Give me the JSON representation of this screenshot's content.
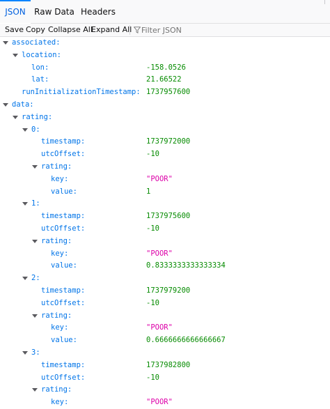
{
  "tabs": [
    {
      "label": "JSON",
      "active": true
    },
    {
      "label": "Raw Data",
      "active": false
    },
    {
      "label": "Headers",
      "active": false
    }
  ],
  "toolbar": {
    "save": "Save",
    "copy": "Copy",
    "collapse_all": "Collapse All",
    "expand_all": "Expand All",
    "filter_placeholder": "Filter JSON"
  },
  "colors": {
    "accent": "#0a84ff",
    "key": "#0074e8",
    "number": "#058b00",
    "string": "#dd00a9"
  },
  "tree": [
    {
      "key": "associated:",
      "level": 0,
      "expandable": true
    },
    {
      "key": "location:",
      "level": 1,
      "expandable": true
    },
    {
      "key": "lon:",
      "level": 2,
      "value": "-158.0526",
      "type": "number"
    },
    {
      "key": "lat:",
      "level": 2,
      "value": "21.66522",
      "type": "number"
    },
    {
      "key": "runInitializationTimestamp:",
      "level": 1,
      "value": "1737957600",
      "type": "number"
    },
    {
      "key": "data:",
      "level": 0,
      "expandable": true
    },
    {
      "key": "rating:",
      "level": 1,
      "expandable": true
    },
    {
      "key": "0:",
      "level": 2,
      "expandable": true
    },
    {
      "key": "timestamp:",
      "level": 3,
      "value": "1737972000",
      "type": "number"
    },
    {
      "key": "utcOffset:",
      "level": 3,
      "value": "-10",
      "type": "number"
    },
    {
      "key": "rating:",
      "level": 3,
      "expandable": true
    },
    {
      "key": "key:",
      "level": 4,
      "value": "\"POOR\"",
      "type": "string"
    },
    {
      "key": "value:",
      "level": 4,
      "value": "1",
      "type": "number"
    },
    {
      "key": "1:",
      "level": 2,
      "expandable": true
    },
    {
      "key": "timestamp:",
      "level": 3,
      "value": "1737975600",
      "type": "number"
    },
    {
      "key": "utcOffset:",
      "level": 3,
      "value": "-10",
      "type": "number"
    },
    {
      "key": "rating:",
      "level": 3,
      "expandable": true
    },
    {
      "key": "key:",
      "level": 4,
      "value": "\"POOR\"",
      "type": "string"
    },
    {
      "key": "value:",
      "level": 4,
      "value": "0.8333333333333334",
      "type": "number"
    },
    {
      "key": "2:",
      "level": 2,
      "expandable": true
    },
    {
      "key": "timestamp:",
      "level": 3,
      "value": "1737979200",
      "type": "number"
    },
    {
      "key": "utcOffset:",
      "level": 3,
      "value": "-10",
      "type": "number"
    },
    {
      "key": "rating:",
      "level": 3,
      "expandable": true
    },
    {
      "key": "key:",
      "level": 4,
      "value": "\"POOR\"",
      "type": "string"
    },
    {
      "key": "value:",
      "level": 4,
      "value": "0.6666666666666667",
      "type": "number"
    },
    {
      "key": "3:",
      "level": 2,
      "expandable": true
    },
    {
      "key": "timestamp:",
      "level": 3,
      "value": "1737982800",
      "type": "number"
    },
    {
      "key": "utcOffset:",
      "level": 3,
      "value": "-10",
      "type": "number"
    },
    {
      "key": "rating:",
      "level": 3,
      "expandable": true
    },
    {
      "key": "key:",
      "level": 4,
      "value": "\"POOR\"",
      "type": "string"
    }
  ]
}
